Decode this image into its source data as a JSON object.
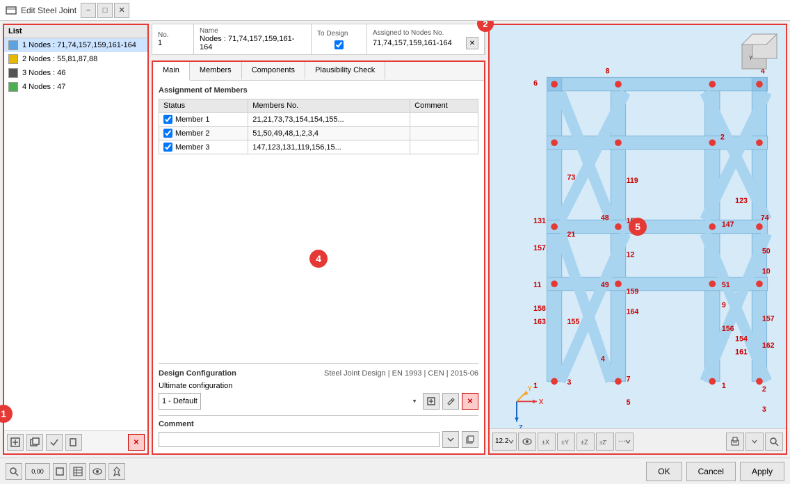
{
  "titleBar": {
    "title": "Edit Steel Joint",
    "minLabel": "−",
    "maxLabel": "□",
    "closeLabel": "✕"
  },
  "leftPanel": {
    "header": "List",
    "items": [
      {
        "id": 1,
        "color": "#5ba3e0",
        "label": "Nodes : 71,74,157,159,161-164",
        "selected": true
      },
      {
        "id": 2,
        "color": "#e6b800",
        "label": "Nodes : 55,81,87,88",
        "selected": false
      },
      {
        "id": 3,
        "color": "#555555",
        "label": "Nodes : 46",
        "selected": false
      },
      {
        "id": 4,
        "color": "#4caf50",
        "label": "Nodes : 47",
        "selected": false
      }
    ],
    "footerButtons": [
      "new",
      "duplicate",
      "check",
      "copy",
      "delete"
    ],
    "badge": "1"
  },
  "infoBar": {
    "noHeader": "No.",
    "noValue": "1",
    "nameHeader": "Name",
    "nameValue": "Nodes : 71,74,157,159,161-164",
    "toDesignHeader": "To Design",
    "toDesignChecked": true,
    "assignedHeader": "Assigned to Nodes No.",
    "assignedValue": "71,74,157,159,161-164",
    "badge": "2"
  },
  "tabs": {
    "items": [
      "Main",
      "Members",
      "Components",
      "Plausibility Check"
    ],
    "active": "Main"
  },
  "membersSection": {
    "title": "Assignment of Members",
    "columns": [
      "Status",
      "Members No.",
      "Comment"
    ],
    "rows": [
      {
        "checked": true,
        "name": "Member 1",
        "membersNo": "21,21,73,73,154,154,155...",
        "comment": ""
      },
      {
        "checked": true,
        "name": "Member 2",
        "membersNo": "51,50,49,48,1,2,3,4",
        "comment": ""
      },
      {
        "checked": true,
        "name": "Member 3",
        "membersNo": "147,123,131,119,156,15...",
        "comment": ""
      }
    ],
    "badge": "4"
  },
  "designConfig": {
    "label": "Design Configuration",
    "value": "Steel Joint Design | EN 1993 | CEN | 2015-06",
    "ultimateLabel": "Ultimate configuration",
    "selectValue": "1 - Default"
  },
  "comment": {
    "label": "Comment",
    "placeholder": ""
  },
  "viewport": {
    "badge": "5",
    "labels": [
      "8",
      "6",
      "4",
      "2",
      "119",
      "159",
      "123",
      "131",
      "73",
      "157",
      "147",
      "74",
      "48",
      "12",
      "21",
      "50",
      "10",
      "49",
      "11",
      "51",
      "9",
      "158",
      "159",
      "164",
      "163",
      "155",
      "156",
      "154",
      "161",
      "162",
      "3",
      "7",
      "4",
      "5",
      "1",
      "2",
      "3"
    ],
    "toolbarButtons": [
      "12.2",
      "eye",
      "ix",
      "iy",
      "iz",
      "iz2",
      "more",
      "print",
      "search"
    ]
  },
  "bottomToolbar": {
    "icons": [
      "search",
      "grid",
      "square",
      "table",
      "eye",
      "pin"
    ],
    "coordValue": "0,00",
    "buttons": {
      "ok": "OK",
      "cancel": "Cancel",
      "apply": "Apply"
    }
  }
}
